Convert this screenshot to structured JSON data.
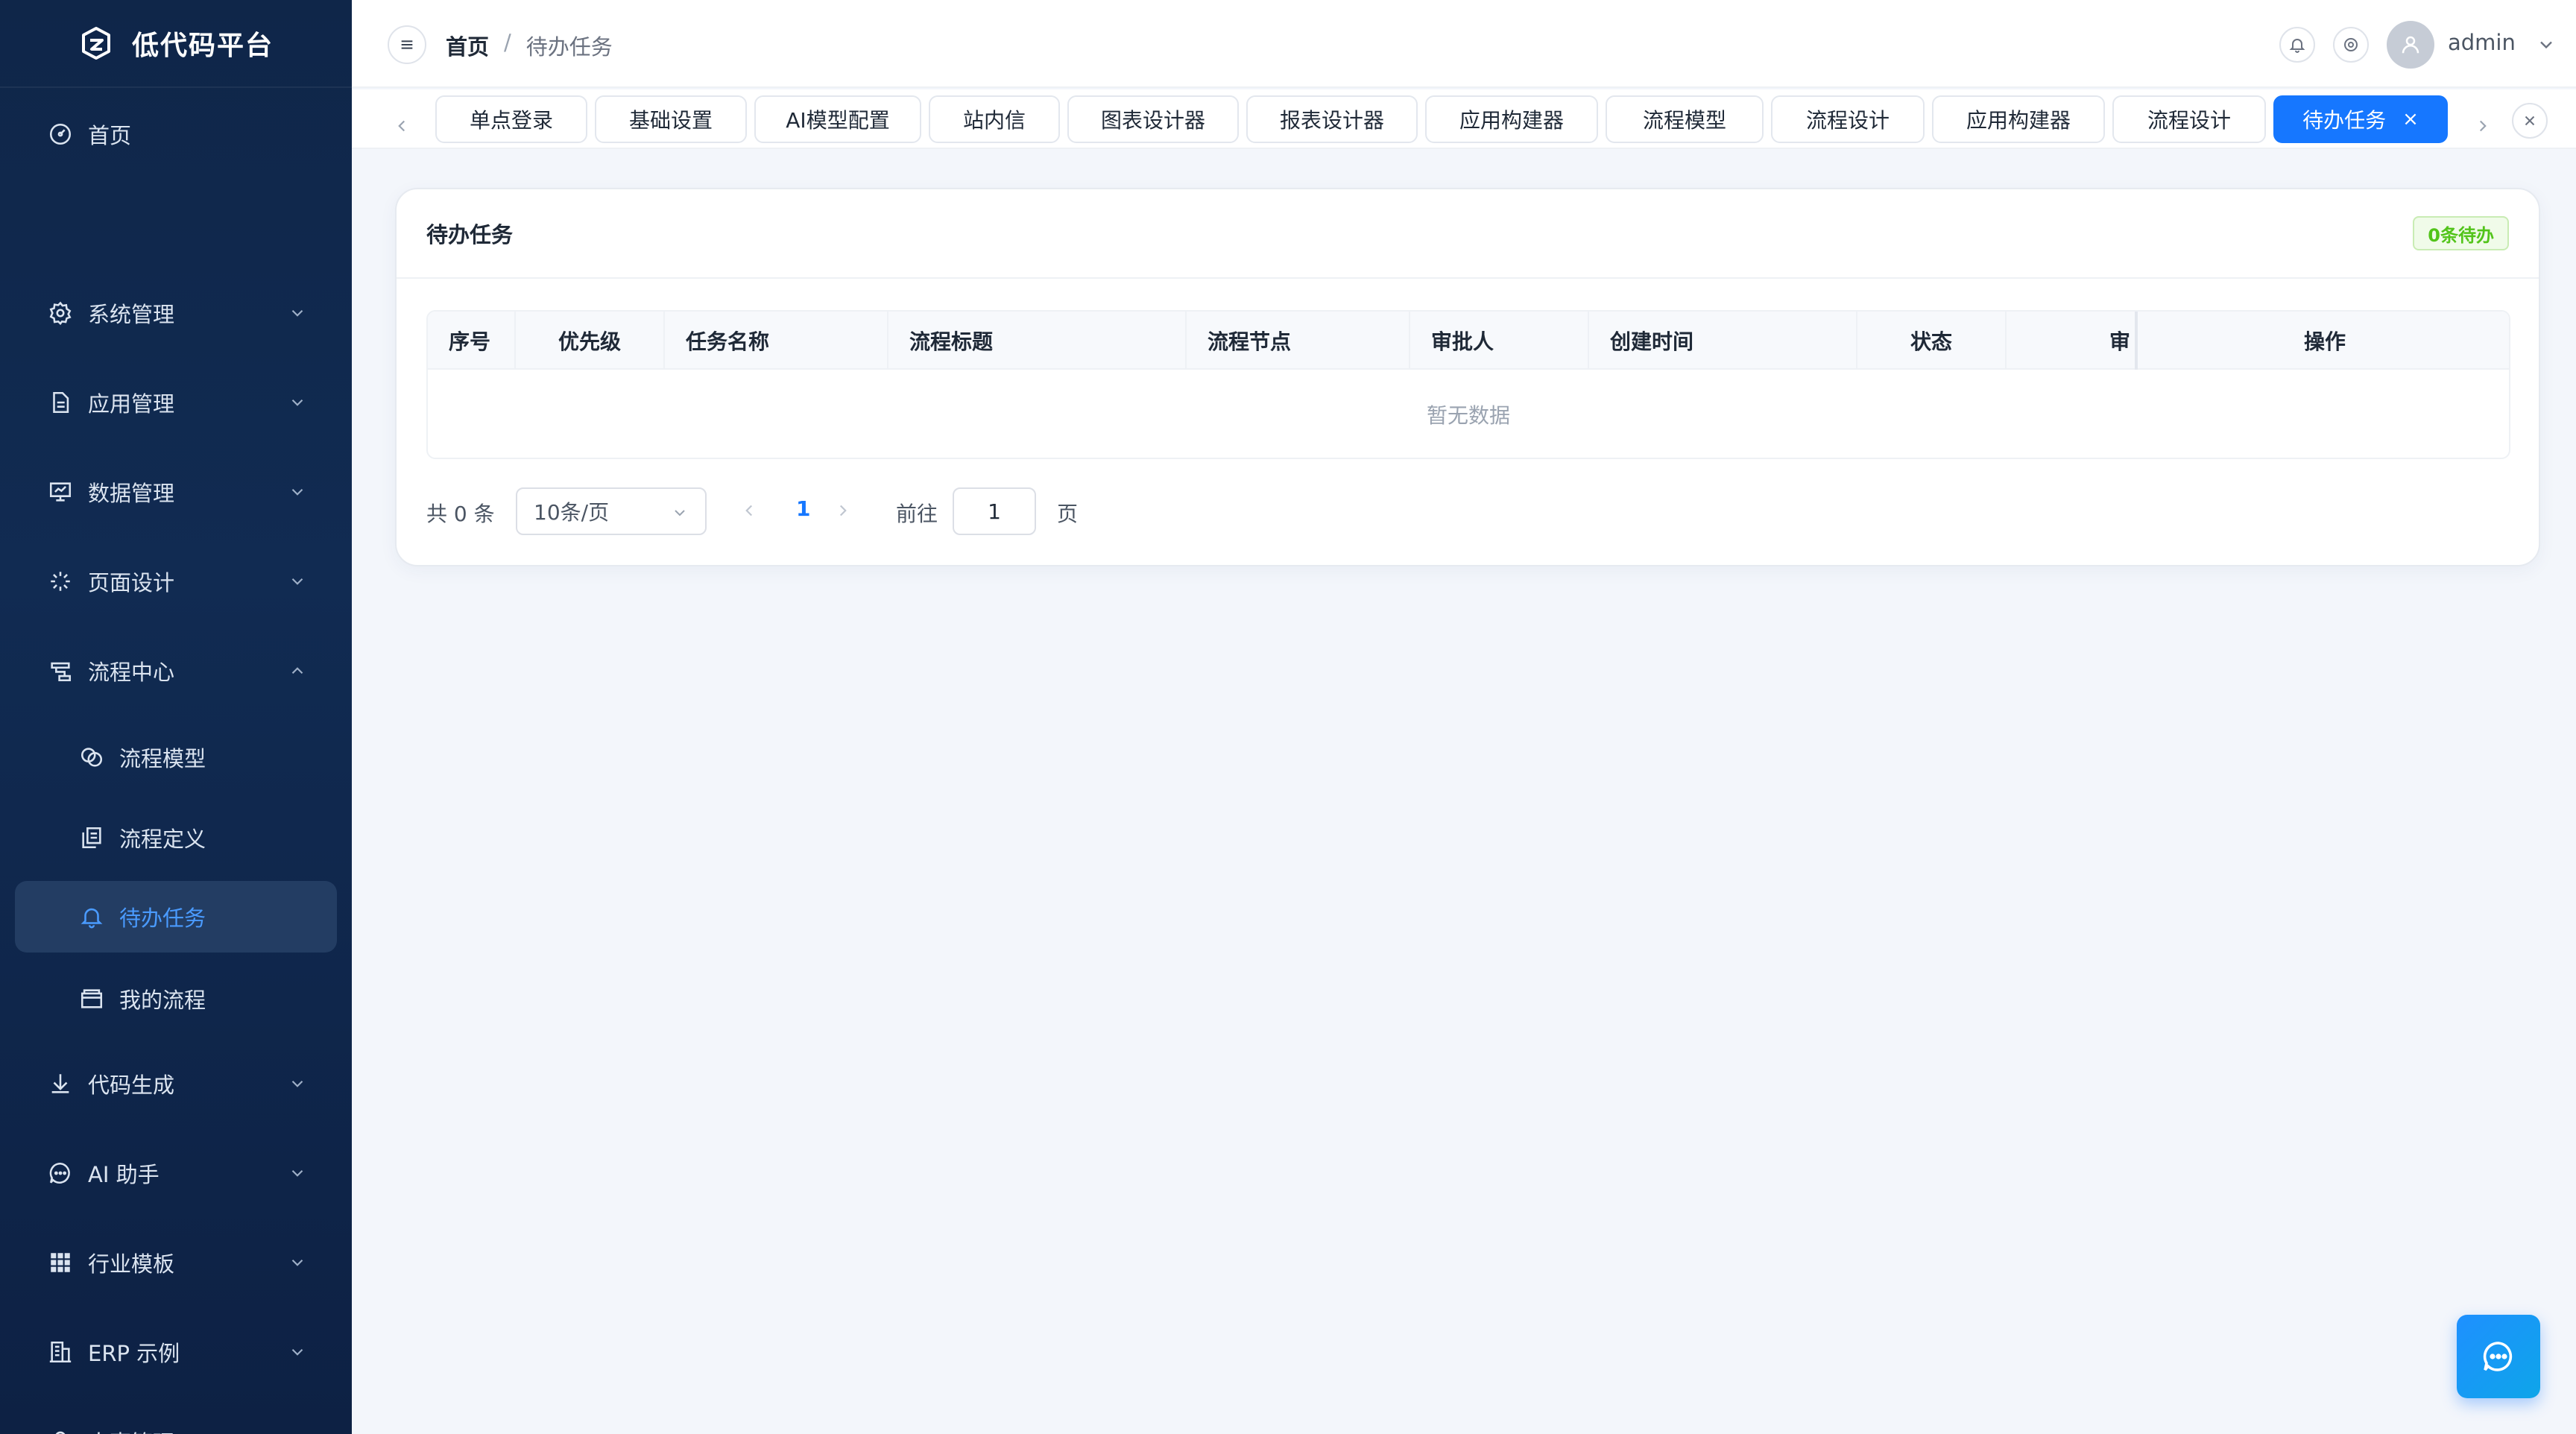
{
  "brand": {
    "name": "低代码平台"
  },
  "sidebar": {
    "items": [
      {
        "label": "首页",
        "icon": "dashboard-icon"
      },
      {
        "label": "系统管理",
        "icon": "gear-icon"
      },
      {
        "label": "应用管理",
        "icon": "document-icon"
      },
      {
        "label": "数据管理",
        "icon": "chart-board-icon"
      },
      {
        "label": "页面设计",
        "icon": "loading-spark-icon"
      },
      {
        "label": "流程中心",
        "icon": "flow-icon",
        "expanded": true
      },
      {
        "label": "流程模型",
        "icon": "link-icon"
      },
      {
        "label": "流程定义",
        "icon": "copy-document-icon"
      },
      {
        "label": "待办任务",
        "icon": "bell-icon",
        "active": true
      },
      {
        "label": "我的流程",
        "icon": "folder-icon"
      },
      {
        "label": "代码生成",
        "icon": "download-icon"
      },
      {
        "label": "AI 助手",
        "icon": "chat-icon"
      },
      {
        "label": "行业模板",
        "icon": "grid-icon"
      },
      {
        "label": "ERP 示例",
        "icon": "office-building-icon"
      },
      {
        "label": "人事管理",
        "icon": "user-icon"
      }
    ]
  },
  "header": {
    "breadcrumb_home": "首页",
    "breadcrumb_sep": "/",
    "breadcrumb_current": "待办任务",
    "username": "admin"
  },
  "tabs": [
    "单点登录",
    "基础设置",
    "AI模型配置",
    "站内信",
    "图表设计器",
    "报表设计器",
    "应用构建器",
    "流程模型",
    "流程设计",
    "应用构建器",
    "流程设计",
    "待办任务"
  ],
  "active_tab": "待办任务",
  "card": {
    "title": "待办任务",
    "badge": "0条待办",
    "columns": [
      "序号",
      "优先级",
      "任务名称",
      "流程标题",
      "流程节点",
      "审批人",
      "创建时间",
      "状态",
      "审",
      "操作"
    ],
    "empty_text": "暂无数据"
  },
  "pager": {
    "total": "共 0 条",
    "page_size": "10条/页",
    "current_page": "1",
    "goto_label": "前往",
    "goto_value": "1",
    "page_unit": "页"
  },
  "colors": {
    "accent": "#1677ff",
    "sidebar_bg": "#0f2649",
    "badge_green": "#52c41a"
  }
}
